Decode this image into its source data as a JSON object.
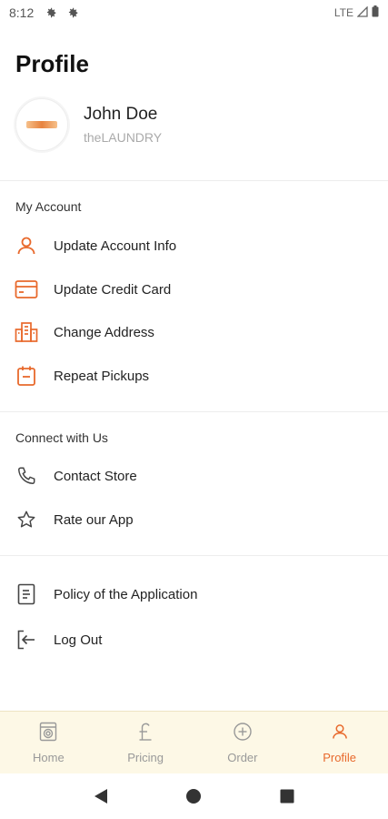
{
  "status_bar": {
    "time": "8:12",
    "network": "LTE"
  },
  "header": {
    "title": "Profile"
  },
  "user": {
    "name": "John Doe",
    "company": "theLAUNDRY"
  },
  "account_section": {
    "label": "My Account",
    "items": [
      {
        "label": "Update Account Info",
        "icon": "person-icon"
      },
      {
        "label": "Update Credit Card",
        "icon": "credit-card-icon"
      },
      {
        "label": "Change Address",
        "icon": "building-icon"
      },
      {
        "label": "Repeat Pickups",
        "icon": "calendar-icon"
      }
    ]
  },
  "connect_section": {
    "label": "Connect with Us",
    "items": [
      {
        "label": "Contact Store",
        "icon": "phone-icon"
      },
      {
        "label": "Rate our App",
        "icon": "star-icon"
      }
    ]
  },
  "other_section": {
    "items": [
      {
        "label": "Policy of the Application",
        "icon": "document-icon"
      },
      {
        "label": "Log Out",
        "icon": "logout-icon"
      }
    ]
  },
  "bottom_nav": {
    "tabs": [
      {
        "label": "Home",
        "icon": "washer-icon",
        "active": false
      },
      {
        "label": "Pricing",
        "icon": "pound-icon",
        "active": false
      },
      {
        "label": "Order",
        "icon": "plus-circle-icon",
        "active": false
      },
      {
        "label": "Profile",
        "icon": "person-icon",
        "active": true
      }
    ]
  },
  "colors": {
    "accent": "#e8692c",
    "nav_background": "#fdf8e6",
    "muted": "#999999"
  }
}
